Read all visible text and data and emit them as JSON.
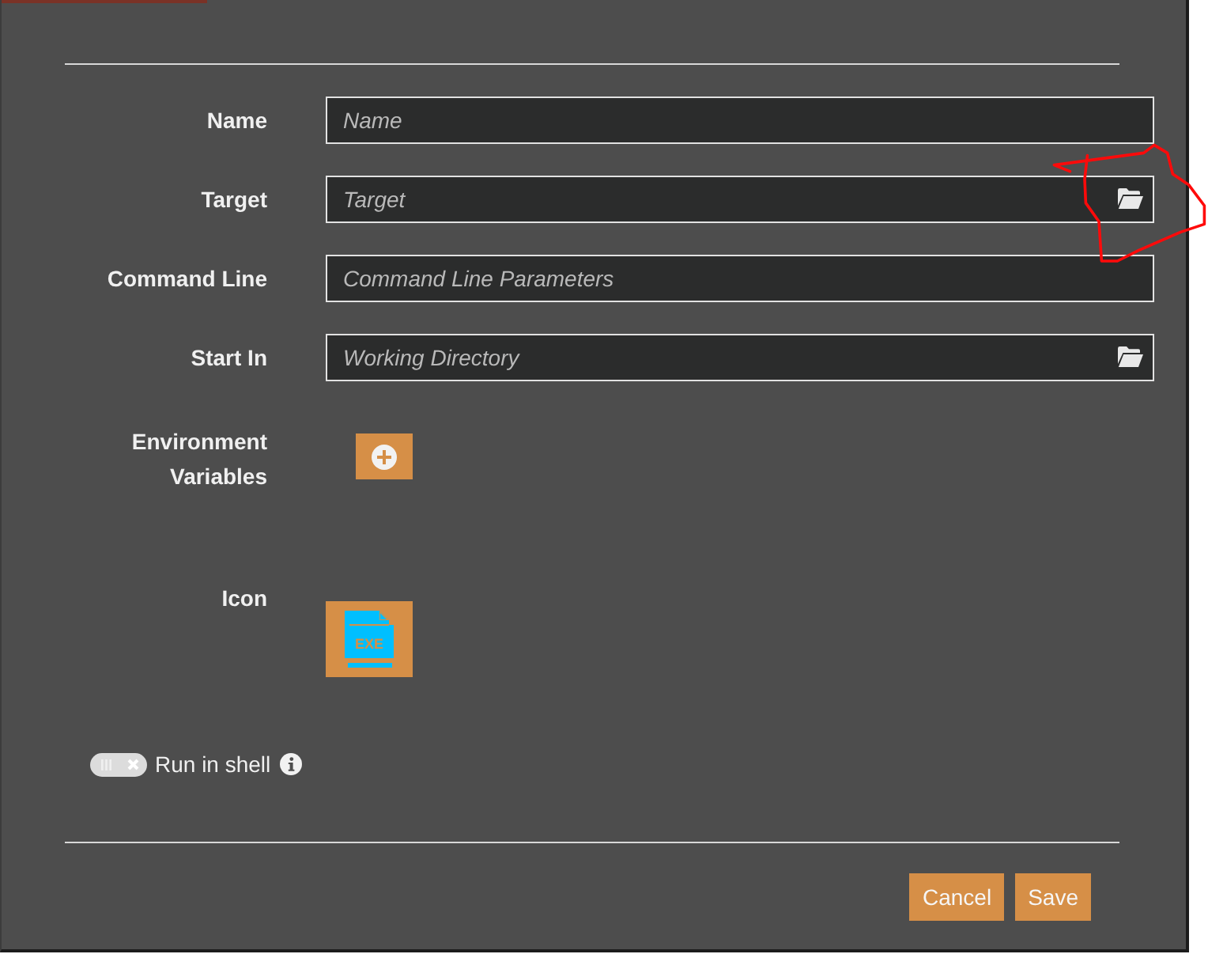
{
  "fields": [
    {
      "label": "Name",
      "placeholder": "Name",
      "browse": false
    },
    {
      "label": "Target",
      "placeholder": "Target",
      "browse": true
    },
    {
      "label": "Command Line",
      "placeholder": "Command Line Parameters",
      "browse": false
    },
    {
      "label": "Start In",
      "placeholder": "Working Directory",
      "browse": true
    }
  ],
  "environment": {
    "label": "Environment Variables"
  },
  "icon": {
    "label": "Icon",
    "file_type": "EXE"
  },
  "run_in_shell": {
    "label": "Run in shell",
    "on": false
  },
  "buttons": [
    {
      "label": "Cancel"
    },
    {
      "label": "Save"
    }
  ]
}
